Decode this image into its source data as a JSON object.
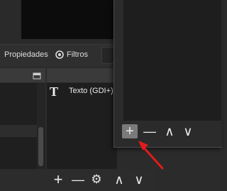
{
  "toolbar": {
    "properties_label": "Propiedades",
    "filters_label": "Filtros"
  },
  "sources": {
    "items": [
      {
        "label": "Texto (GDI+)",
        "icon": "text-icon"
      }
    ]
  },
  "icons": {
    "add": "+",
    "remove": "—",
    "settings": "⚙",
    "up": "∧",
    "down": "∨",
    "text": "T"
  },
  "colors": {
    "accent_arrow": "#e01b1b",
    "highlight": "#7a7a7a"
  }
}
